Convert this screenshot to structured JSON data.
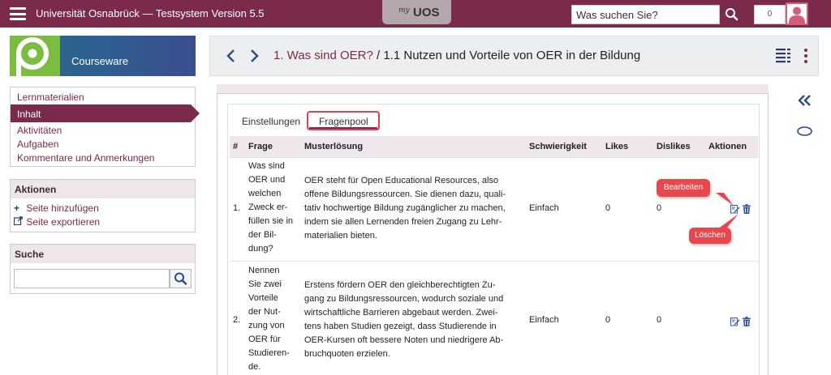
{
  "topbar": {
    "title": "Universität Osnabrück — Testsystem Version 5.5",
    "logo_prefix": "my",
    "logo_text": "UOS",
    "search_placeholder": "Was suchen Sie?",
    "notification_count": "0",
    "color": "#7b2a4b"
  },
  "courseware": {
    "title": "Courseware"
  },
  "nav": {
    "items": [
      {
        "label": "Lernmaterialien",
        "active": false
      },
      {
        "label": "Inhalt",
        "active": true
      },
      {
        "label": "Aktivitäten",
        "active": false
      },
      {
        "label": "Aufgaben",
        "active": false
      },
      {
        "label": "Kommentare und Anmerkungen",
        "active": false
      }
    ]
  },
  "actions": {
    "title": "Aktionen",
    "items": [
      {
        "label": "Seite hinzufügen",
        "icon": "plus-icon"
      },
      {
        "label": "Seite exportieren",
        "icon": "export-icon"
      }
    ]
  },
  "search": {
    "title": "Suche"
  },
  "breadcrumb": {
    "parent": "1. Was sind OER?",
    "separator": " / ",
    "current": "1.1 Nutzen und Vorteile von OER in der Bildung"
  },
  "tabs": [
    {
      "label": "Einstellungen",
      "active": false
    },
    {
      "label": "Fragenpool",
      "active": true
    }
  ],
  "table": {
    "headers": [
      "#",
      "Frage",
      "Musterlösung",
      "Schwierigkeit",
      "Likes",
      "Dislikes",
      "Aktionen"
    ],
    "rows": [
      {
        "num": "1.",
        "question_lines": [
          "Was sind",
          "OER und",
          "welchen",
          "Zweck er-",
          "füllen sie in",
          "der Bil-",
          "dung?"
        ],
        "answer_lines": [
          "OER steht für Open Educational Resources, also",
          "offene Bildungsressourcen. Sie dienen dazu, quali-",
          "tativ hochwertige Bildung zugänglicher zu machen,",
          "indem sie allen Lernenden freien Zugang zu Lehr-",
          "materialien bieten."
        ],
        "difficulty": "Einfach",
        "likes": "0",
        "dislikes": "0"
      },
      {
        "num": "2.",
        "question_lines": [
          "Nennen",
          "Sie zwei",
          "Vorteile",
          "der Nut-",
          "zung von",
          "OER für",
          "Studieren-",
          "de."
        ],
        "answer_lines": [
          "Erstens fördern OER den gleichberechtigten Zu-",
          "gang zu Bildungsressourcen, wodurch soziale und",
          "wirtschaftliche Barrieren abgebaut werden. Zwei-",
          "tens haben Studien gezeigt, dass Studierende in",
          "OER-Kursen oft bessere Noten und niedrigere Ab-",
          "bruchquoten erzielen."
        ],
        "difficulty": "Einfach",
        "likes": "0",
        "dislikes": "0"
      }
    ]
  },
  "callouts": {
    "edit": "Bearbeiten",
    "delete": "Löschen"
  },
  "colors": {
    "accent": "#7b2a4b",
    "callout": "#e8474d",
    "link": "#7b2a4b"
  }
}
